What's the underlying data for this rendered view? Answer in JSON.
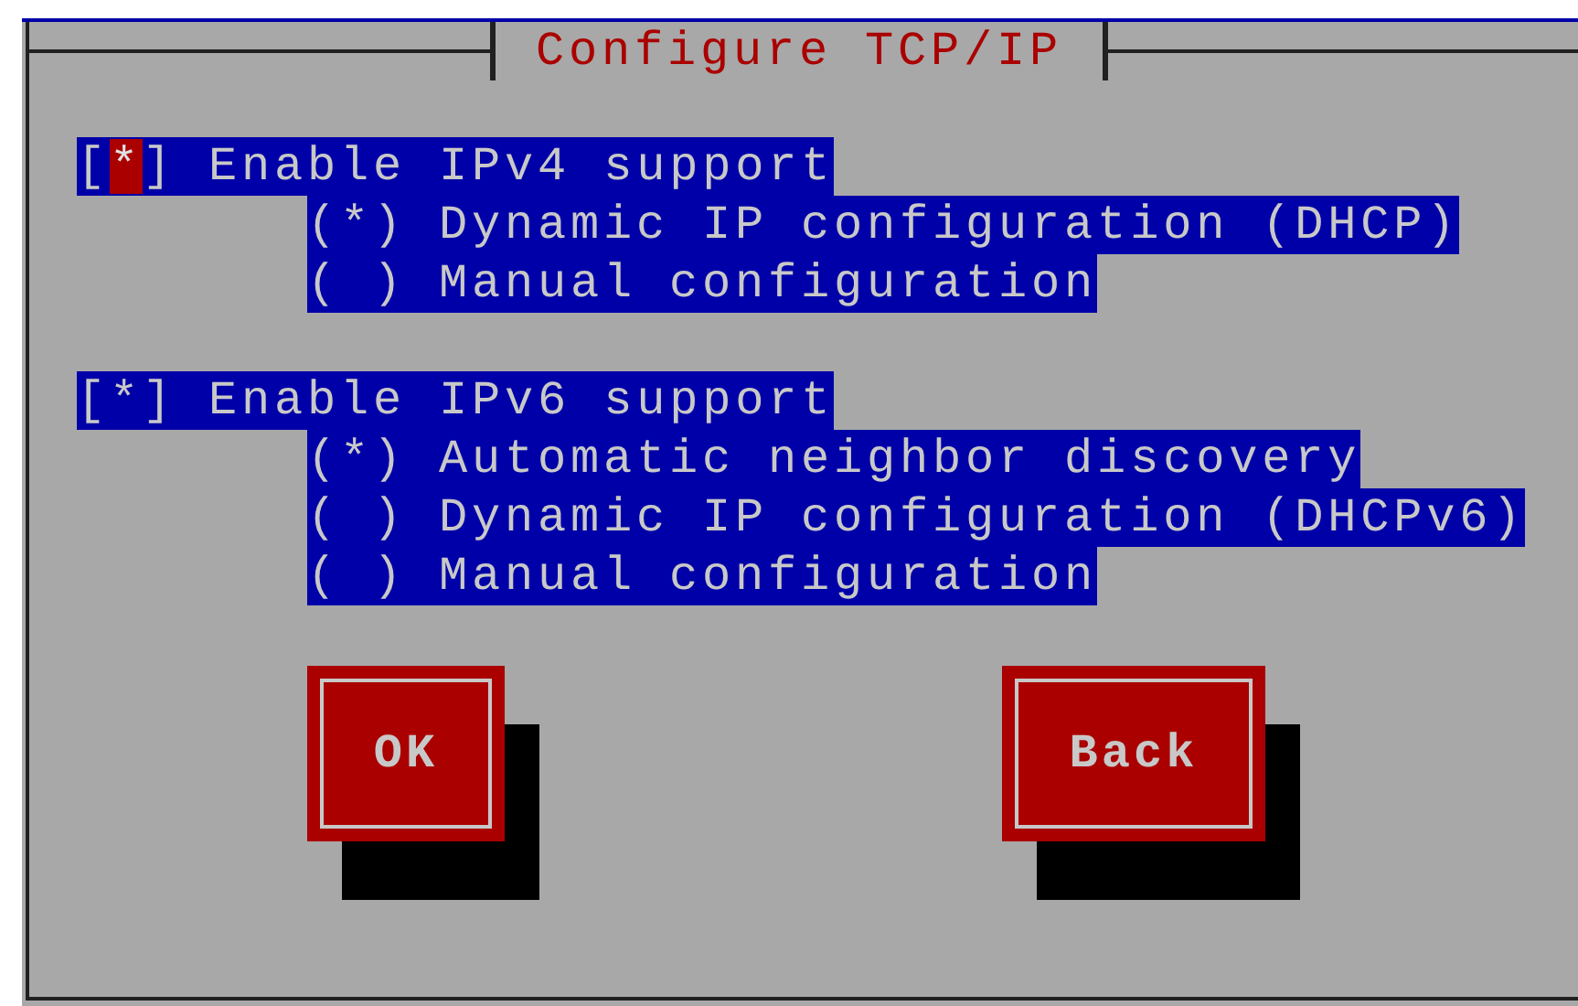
{
  "dialog": {
    "title": "Configure TCP/IP"
  },
  "groups": [
    {
      "checkbox": {
        "box": "[*]",
        "label": "Enable IPv4 support",
        "focused": true
      },
      "options": [
        {
          "box": "(*)",
          "label": "Dynamic IP configuration (DHCP)"
        },
        {
          "box": "( )",
          "label": "Manual configuration"
        }
      ]
    },
    {
      "checkbox": {
        "box": "[*]",
        "label": "Enable IPv6 support",
        "focused": false
      },
      "options": [
        {
          "box": "(*)",
          "label": "Automatic neighbor discovery"
        },
        {
          "box": "( )",
          "label": "Dynamic IP configuration (DHCPv6)"
        },
        {
          "box": "( )",
          "label": "Manual configuration"
        }
      ]
    }
  ],
  "buttons": [
    {
      "label": "OK"
    },
    {
      "label": "Back"
    }
  ]
}
